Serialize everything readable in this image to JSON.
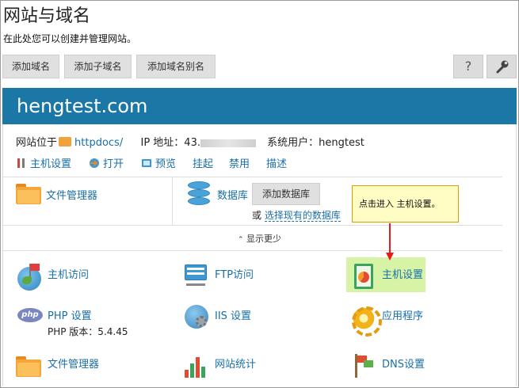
{
  "page": {
    "title": "网站与域名",
    "subtitle": "在此处您可以创建并管理网站。"
  },
  "toolbar": {
    "add_domain": "添加域名",
    "add_subdomain": "添加子域名",
    "add_alias": "添加域名别名",
    "help_label": "?",
    "settings_icon": "wrench-icon"
  },
  "domain": {
    "name": "hengtest.com",
    "site_location_label": "网站位于",
    "site_location_link": "httpdocs/",
    "ip_label": "IP 地址：43.",
    "sys_user_label": "系统用户：",
    "sys_user_value": "hengtest"
  },
  "actions": {
    "host_settings": "主机设置",
    "open": "打开",
    "preview": "预览",
    "suspend": "挂起",
    "disable": "禁用",
    "describe": "描述"
  },
  "boxes": {
    "file_manager": "文件管理器",
    "database": "数据库",
    "add_database": "添加数据库",
    "or": "或",
    "select_existing_db": "选择现有的数据库"
  },
  "callout": {
    "text": "点击进入 主机设置。",
    "accent": "#e81a1a"
  },
  "show_less": "显示更少",
  "tools": {
    "host_access": "主机访问",
    "ftp_access": "FTP访问",
    "host_settings": "主机设置",
    "php_settings": "PHP 设置",
    "php_version": "PHP 版本：5.4.45",
    "iis_settings": "IIS 设置",
    "applications": "应用程序",
    "file_manager": "文件管理器",
    "site_stats": "网站统计",
    "dns_settings": "DNS设置"
  },
  "colors": {
    "header_bg": "#1a77a6",
    "link": "#1a6fa7",
    "highlight": "#d7f3a6"
  }
}
